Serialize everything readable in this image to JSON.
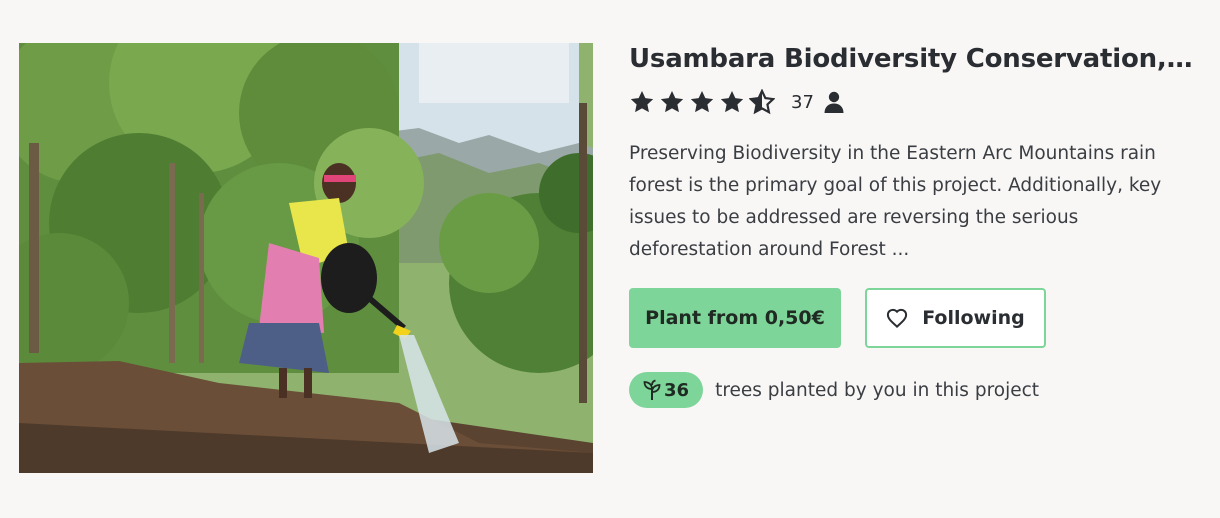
{
  "project": {
    "title": "Usambara Biodiversity Conservation, Tanz...",
    "rating": 4.5,
    "rating_max": 5,
    "rating_count": "37",
    "description": "Preserving Biodiversity in the Eastern Arc Mountains rain forest is the primary goal of this project. Additionally, key issues to be addressed are reversing the serious deforestation around Forest ...",
    "image_icon": "photo-woman-watering-seedlings"
  },
  "actions": {
    "plant_label": "Plant from 0,50€",
    "follow_label": "Following",
    "follow_icon": "heart-icon"
  },
  "trees": {
    "count": "36",
    "icon": "sprout-icon",
    "text": "trees planted by you in this project"
  },
  "colors": {
    "accent": "#7ed59a",
    "text": "#2a2d31",
    "background": "#f8f7f6"
  }
}
